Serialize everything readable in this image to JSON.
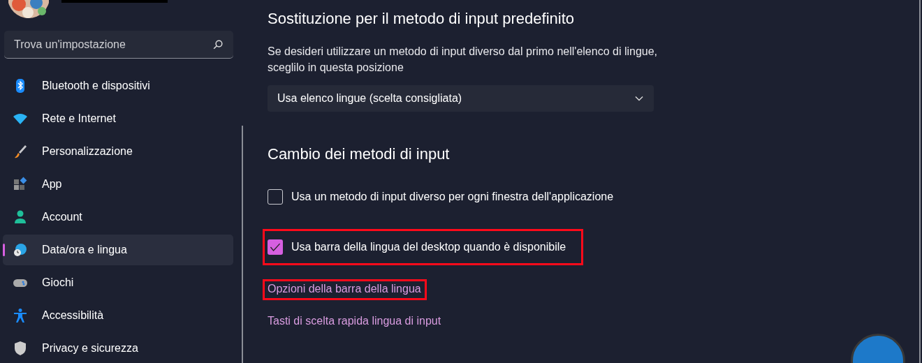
{
  "sidebar": {
    "search": {
      "placeholder": "Trova un'impostazione"
    },
    "items": [
      {
        "label": "Bluetooth e dispositivi",
        "selected": false
      },
      {
        "label": "Rete e Internet",
        "selected": false
      },
      {
        "label": "Personalizzazione",
        "selected": false
      },
      {
        "label": "App",
        "selected": false
      },
      {
        "label": "Account",
        "selected": false
      },
      {
        "label": "Data/ora e lingua",
        "selected": true
      },
      {
        "label": "Giochi",
        "selected": false
      },
      {
        "label": "Accessibilità",
        "selected": false
      },
      {
        "label": "Privacy e sicurezza",
        "selected": false
      }
    ]
  },
  "content": {
    "sections": [
      {
        "title": "Sostituzione per il metodo di input predefinito",
        "description": "Se desideri utilizzare un metodo di input diverso dal primo nell'elenco di lingue, sceglilo in questa posizione",
        "dropdown": {
          "value": "Usa elenco lingue (scelta consigliata)"
        }
      },
      {
        "title": "Cambio dei metodi di input",
        "options": [
          {
            "kind": "checkbox",
            "label": "Usa un metodo di input diverso per ogni finestra dell'applicazione",
            "checked": false,
            "highlighted": false
          },
          {
            "kind": "checkbox",
            "label": "Usa barra della lingua del desktop quando è disponibile",
            "checked": true,
            "highlighted": true
          },
          {
            "kind": "link",
            "label": "Opzioni della barra della lingua",
            "highlighted": true
          },
          {
            "kind": "link",
            "label": "Tasti di scelta rapida lingua di input",
            "highlighted": false
          }
        ]
      }
    ]
  }
}
